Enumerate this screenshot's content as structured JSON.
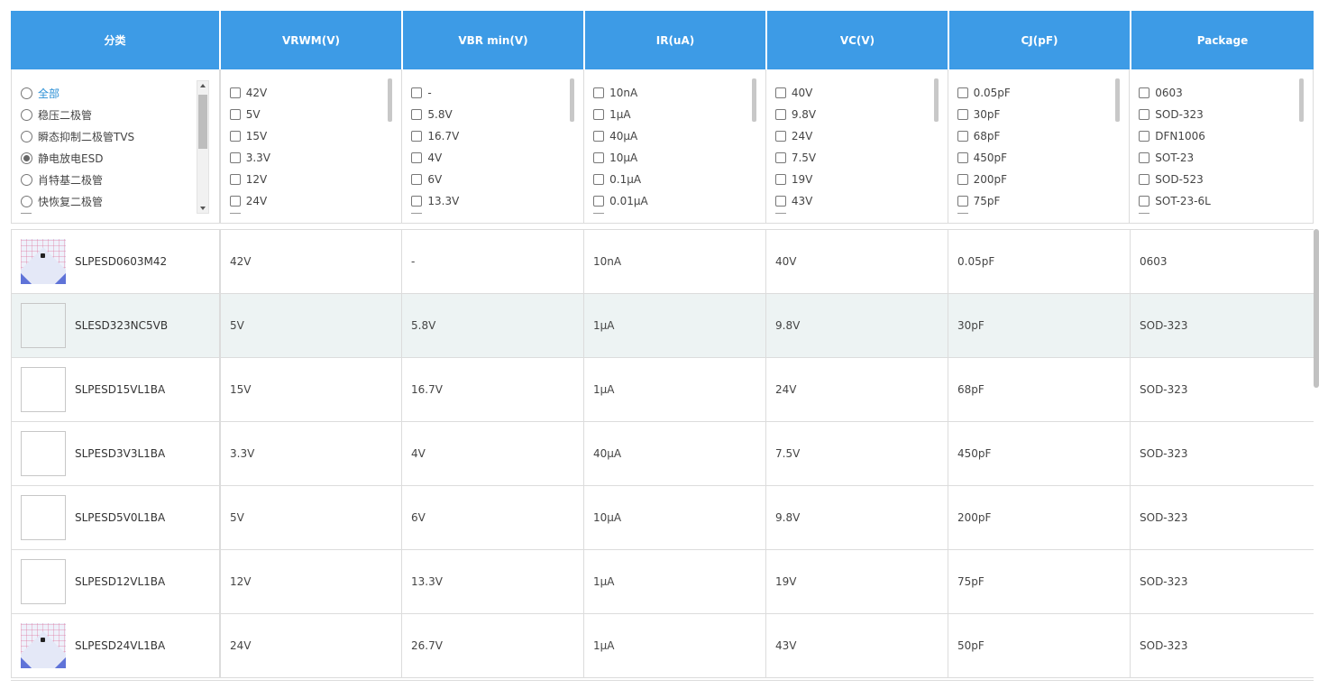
{
  "columns": [
    "分类",
    "VRWM(V)",
    "VBR min(V)",
    "IR(uA)",
    "VC(V)",
    "CJ(pF)",
    "Package"
  ],
  "categories": [
    {
      "label": "全部",
      "selected": false,
      "active": true
    },
    {
      "label": "稳压二极管",
      "selected": false,
      "active": false
    },
    {
      "label": "瞬态抑制二极管TVS",
      "selected": false,
      "active": false
    },
    {
      "label": "静电放电ESD",
      "selected": true,
      "active": false
    },
    {
      "label": "肖特基二极管",
      "selected": false,
      "active": false
    },
    {
      "label": "快恢复二极管",
      "selected": false,
      "active": false
    }
  ],
  "filters": {
    "vrwm": [
      "42V",
      "5V",
      "15V",
      "3.3V",
      "12V",
      "24V"
    ],
    "vbr": [
      "-",
      "5.8V",
      "16.7V",
      "4V",
      "6V",
      "13.3V"
    ],
    "ir": [
      "10nA",
      "1μA",
      "40μA",
      "10μA",
      "0.1μA",
      "0.01μA"
    ],
    "vc": [
      "40V",
      "9.8V",
      "24V",
      "7.5V",
      "19V",
      "43V"
    ],
    "cj": [
      "0.05pF",
      "30pF",
      "68pF",
      "450pF",
      "200pF",
      "75pF"
    ],
    "package": [
      "0603",
      "SOD-323",
      "DFN1006",
      "SOT-23",
      "SOD-523",
      "SOT-23-6L"
    ]
  },
  "products": [
    {
      "name": "SLPESD0603M42",
      "vrwm": "42V",
      "vbr": "-",
      "ir": "10nA",
      "vc": "40V",
      "cj": "0.05pF",
      "package": "0603",
      "image": "chip-photo",
      "highlight": false
    },
    {
      "name": "SLESD323NC5VB",
      "vrwm": "5V",
      "vbr": "5.8V",
      "ir": "1μA",
      "vc": "9.8V",
      "cj": "30pF",
      "package": "SOD-323",
      "image": "placeholder",
      "highlight": true
    },
    {
      "name": "SLPESD15VL1BA",
      "vrwm": "15V",
      "vbr": "16.7V",
      "ir": "1μA",
      "vc": "24V",
      "cj": "68pF",
      "package": "SOD-323",
      "image": "placeholder",
      "highlight": false
    },
    {
      "name": "SLPESD3V3L1BA",
      "vrwm": "3.3V",
      "vbr": "4V",
      "ir": "40μA",
      "vc": "7.5V",
      "cj": "450pF",
      "package": "SOD-323",
      "image": "placeholder",
      "highlight": false
    },
    {
      "name": "SLPESD5V0L1BA",
      "vrwm": "5V",
      "vbr": "6V",
      "ir": "10μA",
      "vc": "9.8V",
      "cj": "200pF",
      "package": "SOD-323",
      "image": "placeholder",
      "highlight": false
    },
    {
      "name": "SLPESD12VL1BA",
      "vrwm": "12V",
      "vbr": "13.3V",
      "ir": "1μA",
      "vc": "19V",
      "cj": "75pF",
      "package": "SOD-323",
      "image": "placeholder",
      "highlight": false
    },
    {
      "name": "SLPESD24VL1BA",
      "vrwm": "24V",
      "vbr": "26.7V",
      "ir": "1μA",
      "vc": "43V",
      "cj": "50pF",
      "package": "SOD-323",
      "image": "chip-photo",
      "highlight": false
    }
  ],
  "colors": {
    "header": "#3d9be6",
    "highlight_row": "#edf3f3",
    "active_link": "#2a8fd6"
  }
}
